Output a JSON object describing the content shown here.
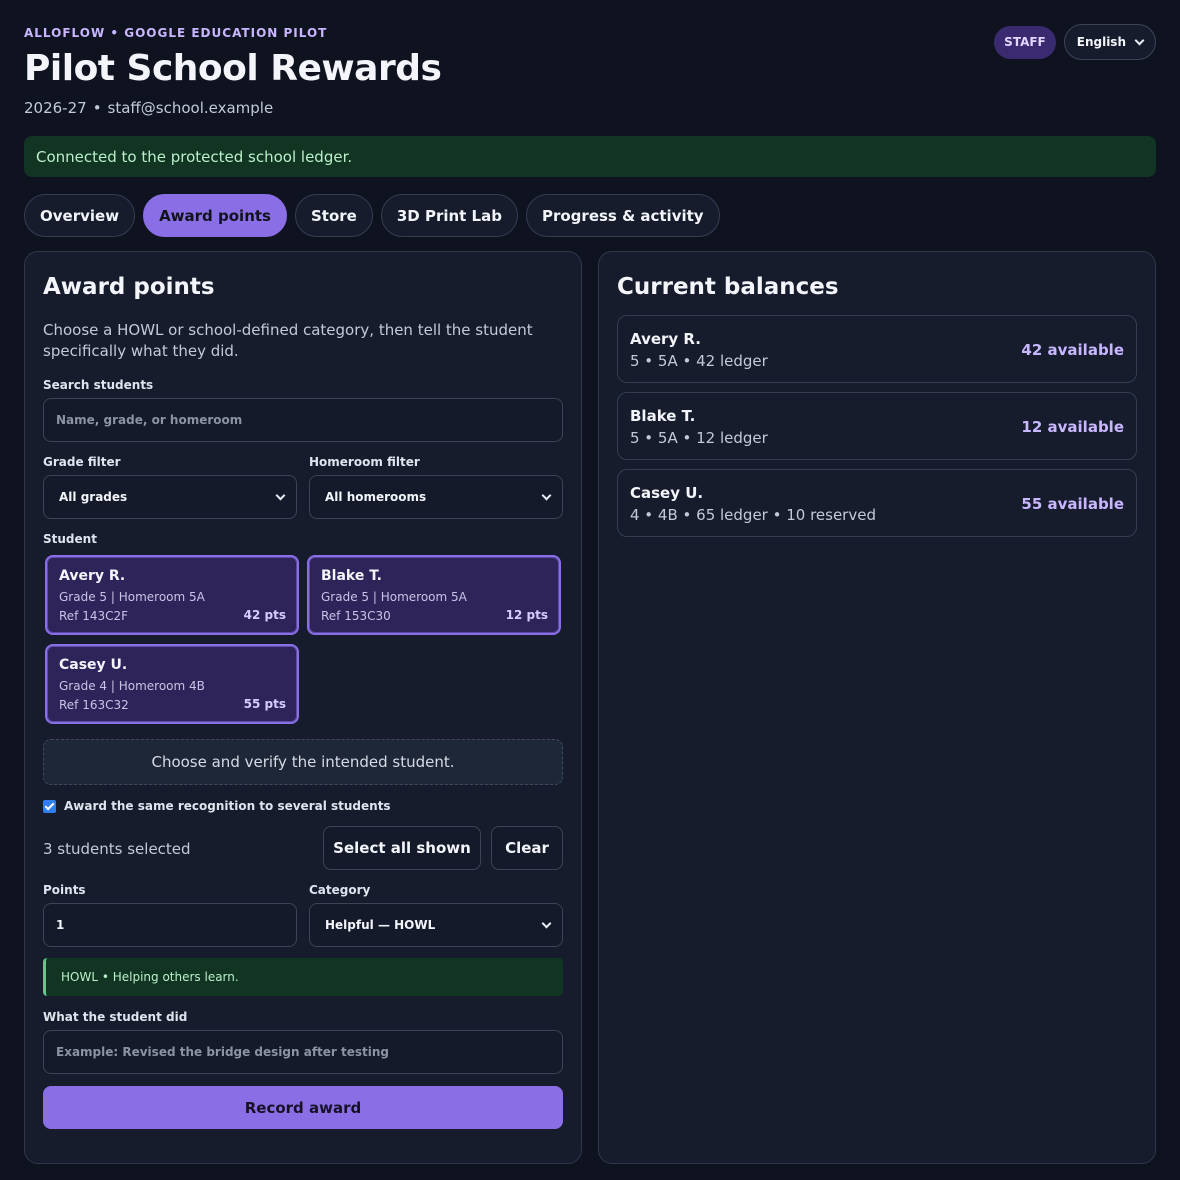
{
  "header": {
    "eyebrow": "ALLOFLOW • GOOGLE EDUCATION PILOT",
    "title": "Pilot School Rewards",
    "year": "2026-27",
    "separator": "•",
    "email": "staff@school.example",
    "role_badge": "STAFF",
    "language": "English"
  },
  "banner": {
    "text": "Connected to the protected school ledger."
  },
  "tabs": [
    {
      "label": "Overview",
      "active": false
    },
    {
      "label": "Award points",
      "active": true
    },
    {
      "label": "Store",
      "active": false
    },
    {
      "label": "3D Print Lab",
      "active": false
    },
    {
      "label": "Progress & activity",
      "active": false
    }
  ],
  "award": {
    "title": "Award points",
    "intro": "Choose a HOWL or school-defined category, then tell the student specifically what they did.",
    "search_label": "Search students",
    "search_placeholder": "Name, grade, or homeroom",
    "grade_label": "Grade filter",
    "grade_value": "All grades",
    "homeroom_label": "Homeroom filter",
    "homeroom_value": "All homerooms",
    "student_label": "Student",
    "students": [
      {
        "name": "Avery R.",
        "meta": "Grade 5 | Homeroom 5A",
        "ref": "Ref 143C2F",
        "pts": "42 pts"
      },
      {
        "name": "Blake T.",
        "meta": "Grade 5 | Homeroom 5A",
        "ref": "Ref 153C30",
        "pts": "12 pts"
      },
      {
        "name": "Casey U.",
        "meta": "Grade 4 | Homeroom 4B",
        "ref": "Ref 163C32",
        "pts": "55 pts"
      }
    ],
    "verify_text": "Choose and verify the intended student.",
    "multi_label": "Award the same recognition to several students",
    "multi_checked": true,
    "selected_count": "3 students selected",
    "select_all_label": "Select all shown",
    "clear_label": "Clear",
    "points_label": "Points",
    "points_value": "1",
    "category_label": "Category",
    "category_value": "Helpful — HOWL",
    "howl_note": "HOWL • Helping others learn.",
    "did_label": "What the student did",
    "did_placeholder": "Example: Revised the bridge design after testing",
    "record_label": "Record award"
  },
  "balances": {
    "title": "Current balances",
    "items": [
      {
        "name": "Avery R.",
        "meta": "5 • 5A • 42 ledger",
        "available": "42 available"
      },
      {
        "name": "Blake T.",
        "meta": "5 • 5A • 12 ledger",
        "available": "12 available"
      },
      {
        "name": "Casey U.",
        "meta": "4 • 4B • 65 ledger • 10 reserved",
        "available": "55 available"
      }
    ]
  }
}
